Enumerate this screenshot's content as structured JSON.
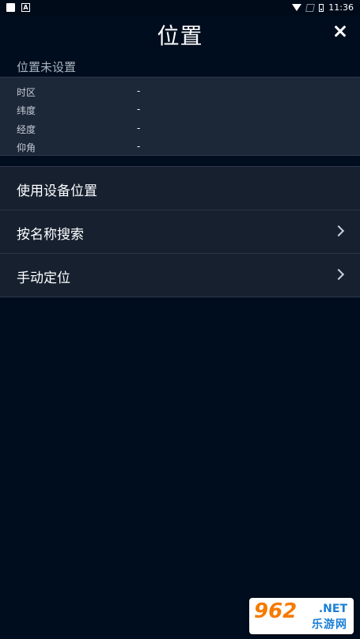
{
  "status_bar": {
    "time": "11:36"
  },
  "header": {
    "title": "位置"
  },
  "location": {
    "status": "位置未设置",
    "fields": [
      {
        "key": "时区",
        "value": "-"
      },
      {
        "key": "纬度",
        "value": "-"
      },
      {
        "key": "经度",
        "value": "-"
      },
      {
        "key": "仰角",
        "value": "-"
      }
    ]
  },
  "menu": [
    {
      "label": "使用设备位置",
      "chevron": false
    },
    {
      "label": "按名称搜索",
      "chevron": true
    },
    {
      "label": "手动定位",
      "chevron": true
    }
  ],
  "watermark": {
    "number": "962",
    "suffix": ".NET",
    "cn": "乐游网"
  }
}
